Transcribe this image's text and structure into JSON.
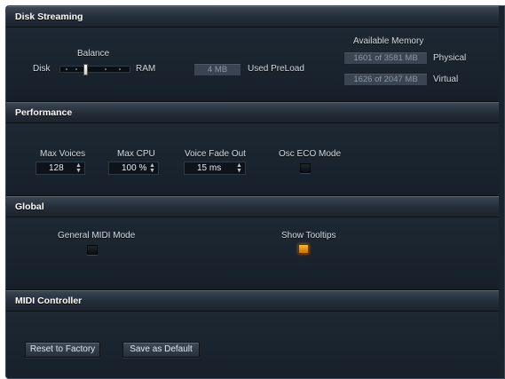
{
  "disk_streaming": {
    "title": "Disk Streaming",
    "balance_label": "Balance",
    "disk_label": "Disk",
    "ram_label": "RAM",
    "balance_value": 0.35,
    "preload_value": "4 MB",
    "preload_label": "Used PreLoad",
    "available_memory_label": "Available Memory",
    "physical_value": "1601 of 3581 MB",
    "physical_label": "Physical",
    "virtual_value": "1626 of 2047 MB",
    "virtual_label": "Virtual"
  },
  "performance": {
    "title": "Performance",
    "max_voices_label": "Max Voices",
    "max_voices_value": "128",
    "max_cpu_label": "Max CPU",
    "max_cpu_value": "100 %",
    "voice_fade_label": "Voice Fade Out",
    "voice_fade_value": "15 ms",
    "osc_eco_label": "Osc ECO Mode",
    "osc_eco_on": false
  },
  "global": {
    "title": "Global",
    "gm_mode_label": "General MIDI Mode",
    "gm_mode_on": false,
    "tooltips_label": "Show Tooltips",
    "tooltips_on": true
  },
  "midi_controller": {
    "title": "MIDI Controller",
    "reset_label": "Reset to Factory",
    "save_label": "Save as Default"
  },
  "colors": {
    "led_on": "#f09a10",
    "background": "#131b25"
  }
}
